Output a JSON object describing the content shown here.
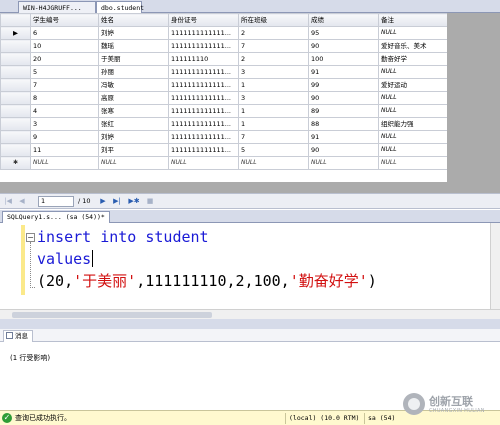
{
  "doc_tabs": [
    "WIN-H4JGRUFF...",
    "dbo.student"
  ],
  "grid": {
    "columns": [
      "学生编号",
      "姓名",
      "身份证号",
      "所在班级",
      "成绩",
      "备注"
    ],
    "current_row_marker": "▶",
    "new_row_marker": "✱",
    "rows": [
      [
        "6",
        "刘婷",
        "1111111111111...",
        "2",
        "95",
        "NULL"
      ],
      [
        "10",
        "魏瑶",
        "1111111111111...",
        "7",
        "90",
        "爱好音乐、美术"
      ],
      [
        "20",
        "于美丽",
        "111111110",
        "2",
        "100",
        "勤奋好学"
      ],
      [
        "5",
        "孙丽",
        "1111111111111...",
        "3",
        "91",
        "NULL"
      ],
      [
        "7",
        "冯敏",
        "1111111111111...",
        "1",
        "99",
        "爱好运动"
      ],
      [
        "8",
        "高原",
        "1111111111111...",
        "3",
        "90",
        "NULL"
      ],
      [
        "4",
        "张寒",
        "1111111111111...",
        "1",
        "89",
        "NULL"
      ],
      [
        "3",
        "张红",
        "1111111111111...",
        "1",
        "88",
        "组织能力强"
      ],
      [
        "9",
        "刘婷",
        "1111111111111...",
        "7",
        "91",
        "NULL"
      ],
      [
        "11",
        "刘平",
        "1111111111111...",
        "5",
        "90",
        "NULL"
      ],
      [
        "NULL",
        "NULL",
        "NULL",
        "NULL",
        "NULL",
        "NULL"
      ]
    ]
  },
  "nav": {
    "first": "|◀",
    "prev": "◀",
    "page": "1",
    "total": "/ 10",
    "next": "▶",
    "last": "▶|",
    "new": "▶✱",
    "stop": "■"
  },
  "query_tab": "SQLQuery1.s... (sa (54))*",
  "editor": {
    "line1": {
      "kw1": "insert",
      "kw2": "into",
      "name": "student"
    },
    "line2": {
      "kw": "values"
    },
    "line3": {
      "open": "(20,",
      "s1": "'于美丽'",
      "mid": ",111111110,2,100,",
      "s2": "'勤奋好学'",
      "close": ")"
    }
  },
  "messages": {
    "tab_label": "消息",
    "text": "(1 行受影响)"
  },
  "status": {
    "text": "查询已成功执行。",
    "server": "(local) (10.0 RTM)",
    "user": "sa (54)"
  },
  "watermark": {
    "cn": "创新互联",
    "en": "CHUANGXIN HULIAN"
  },
  "colors": {
    "keyword": "#1a1ad6",
    "string": "#d21010",
    "status_bar": "#fff9cf",
    "success": "#2e9c36"
  }
}
